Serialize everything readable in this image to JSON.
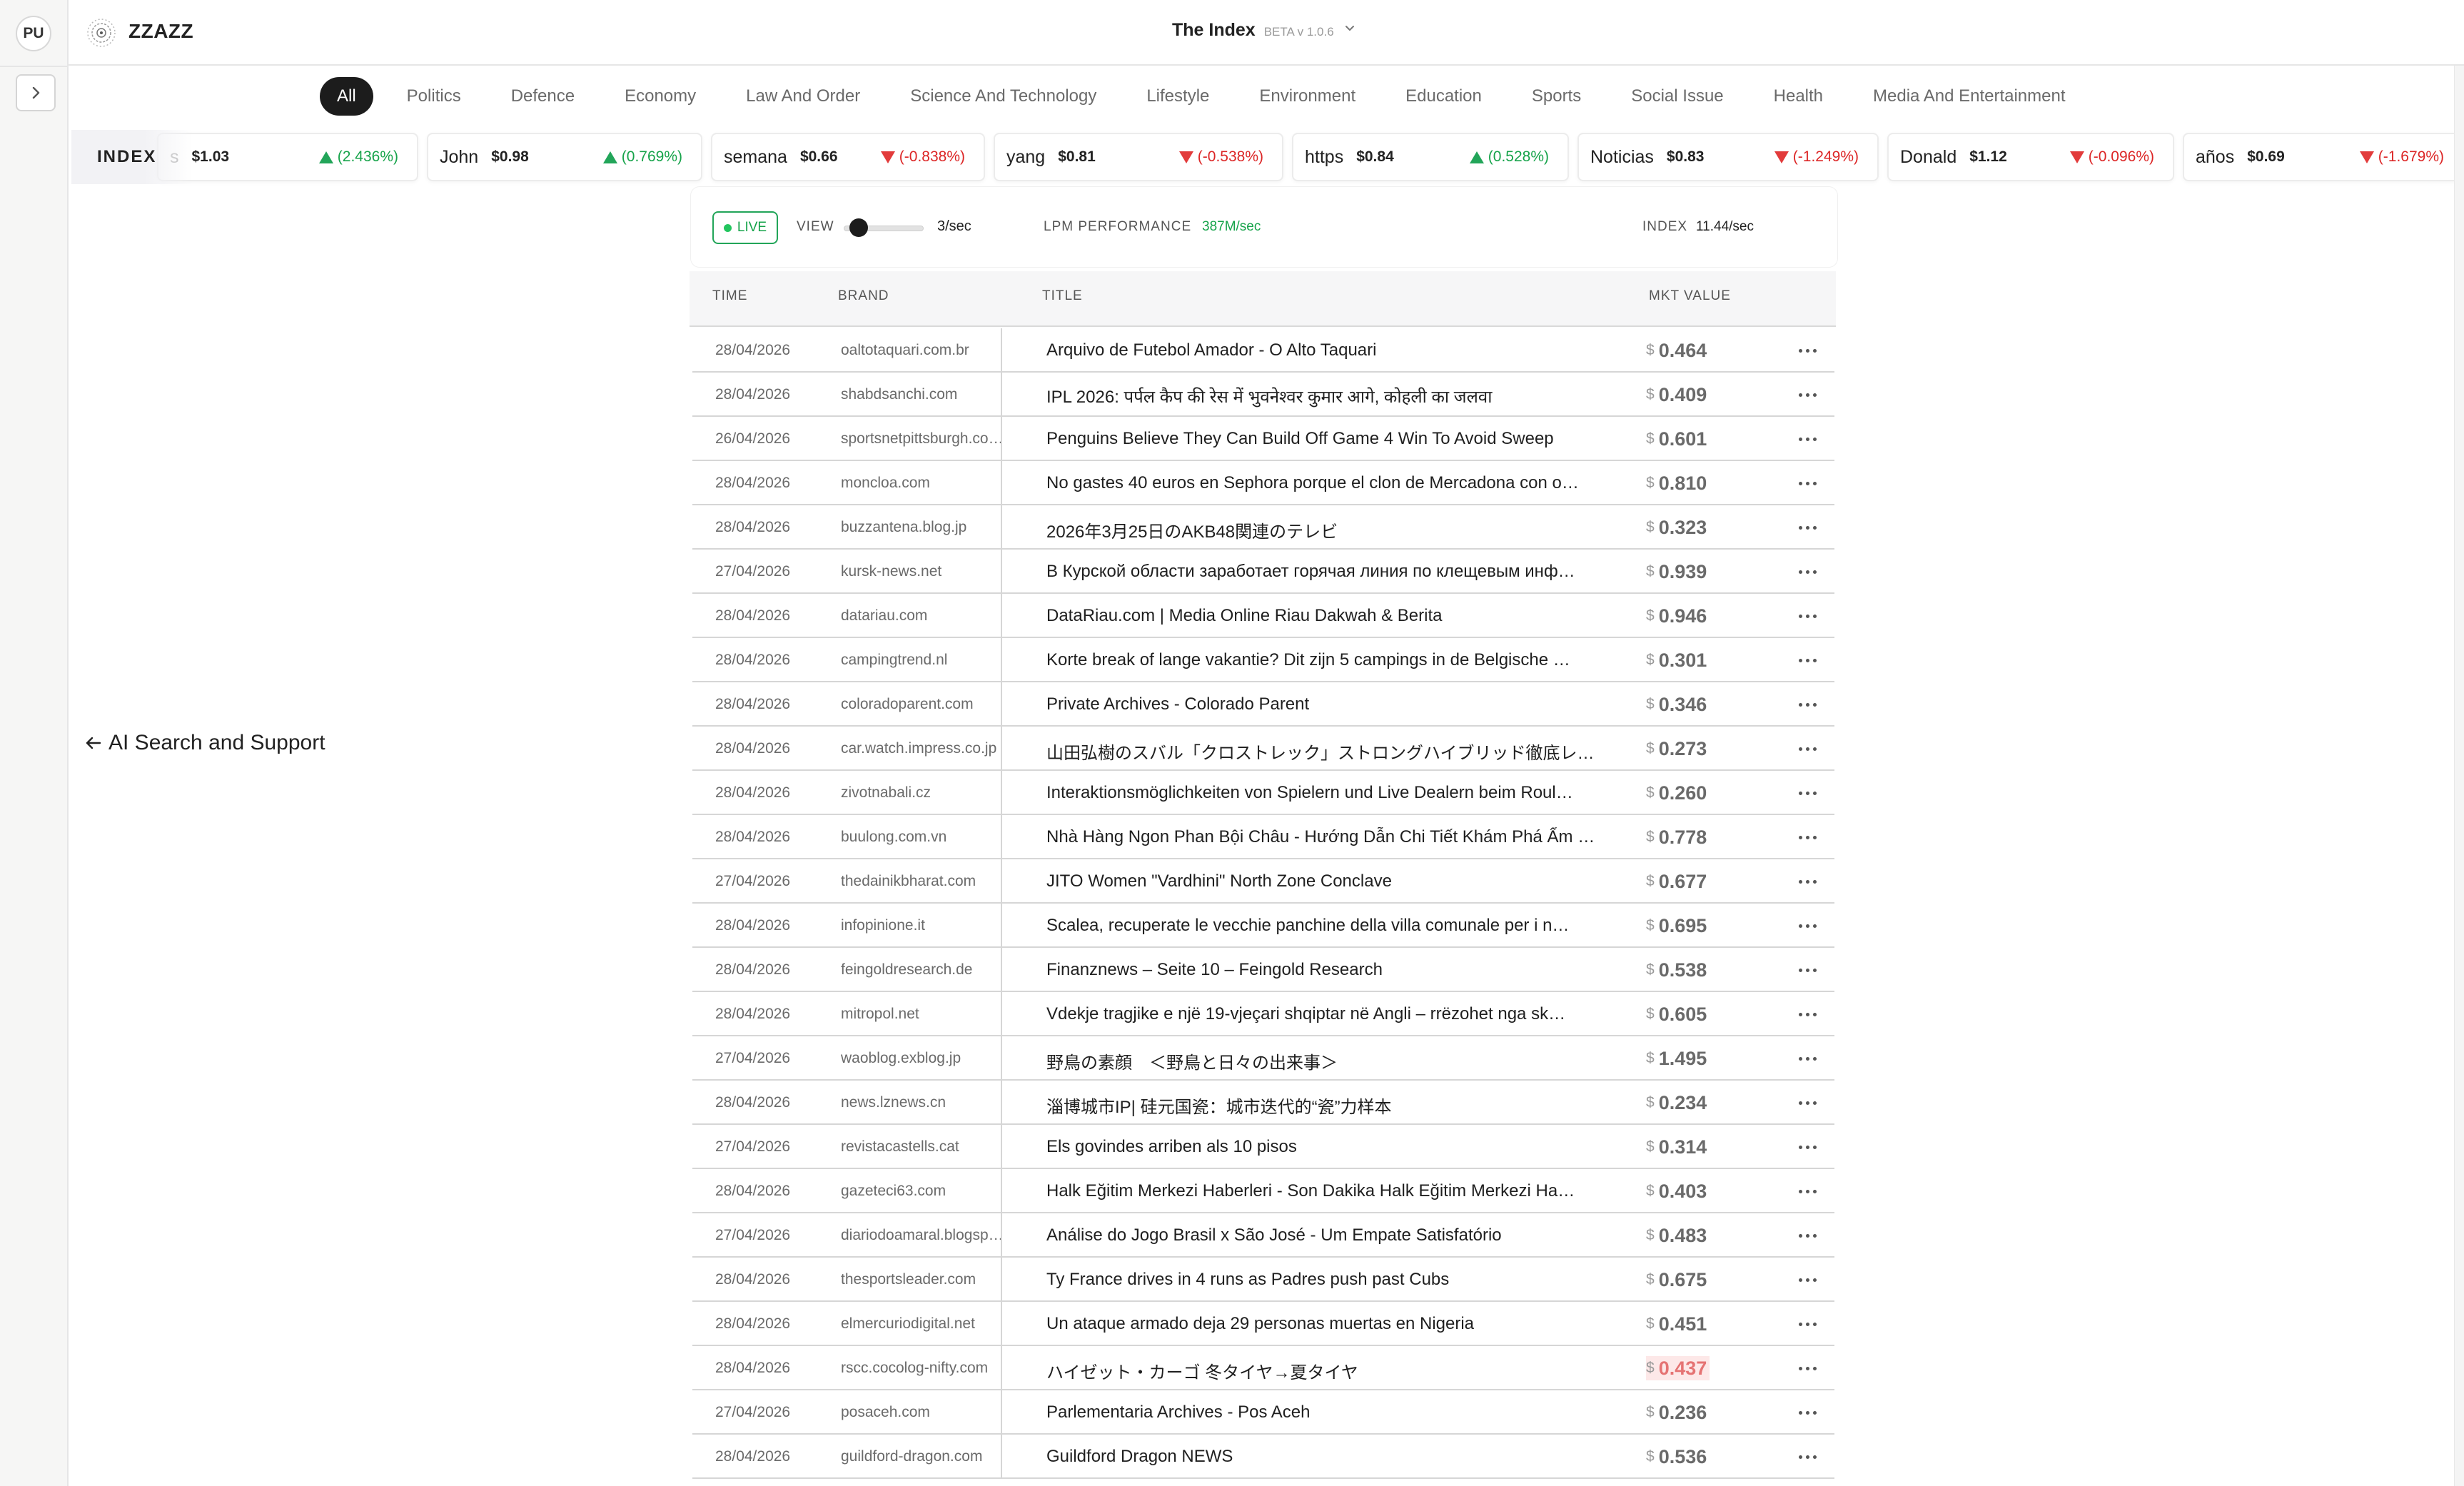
{
  "rail": {
    "avatar": "PU"
  },
  "header": {
    "brand": "ZZAZZ",
    "title": "The Index",
    "version": "BETA v 1.0.6"
  },
  "tabs": [
    {
      "label": "All",
      "active": true
    },
    {
      "label": "Politics"
    },
    {
      "label": "Defence"
    },
    {
      "label": "Economy"
    },
    {
      "label": "Law And Order"
    },
    {
      "label": "Science And Technology"
    },
    {
      "label": "Lifestyle"
    },
    {
      "label": "Environment"
    },
    {
      "label": "Education"
    },
    {
      "label": "Sports"
    },
    {
      "label": "Social Issue"
    },
    {
      "label": "Health"
    },
    {
      "label": "Media And Entertainment"
    }
  ],
  "ticker": {
    "label": "INDEX",
    "items": [
      {
        "name": "s",
        "price": "$1.03",
        "change": "(2.436%)",
        "dir": "up"
      },
      {
        "name": "John",
        "price": "$0.98",
        "change": "(0.769%)",
        "dir": "up"
      },
      {
        "name": "semana",
        "price": "$0.66",
        "change": "(-0.838%)",
        "dir": "down"
      },
      {
        "name": "yang",
        "price": "$0.81",
        "change": "(-0.538%)",
        "dir": "down"
      },
      {
        "name": "https",
        "price": "$0.84",
        "change": "(0.528%)",
        "dir": "up"
      },
      {
        "name": "Noticias",
        "price": "$0.83",
        "change": "(-1.249%)",
        "dir": "down"
      },
      {
        "name": "Donald",
        "price": "$1.12",
        "change": "(-0.096%)",
        "dir": "down"
      },
      {
        "name": "años",
        "price": "$0.69",
        "change": "(-1.679%)",
        "dir": "down"
      }
    ]
  },
  "panel": {
    "live": "LIVE",
    "view_label": "VIEW",
    "view_rate": "3/sec",
    "lpm_label": "LPM PERFORMANCE",
    "lpm_value": "387M/sec",
    "index_label": "INDEX",
    "index_value": "11.44/sec"
  },
  "table": {
    "headers": {
      "time": "TIME",
      "brand": "BRAND",
      "title": "TITLE",
      "value": "MKT VALUE"
    },
    "currency": "$",
    "rows": [
      {
        "time": "28/04/2026",
        "brand": "oaltotaquari.com.br",
        "title": "Arquivo de Futebol Amador - O Alto Taquari",
        "value": "0.464"
      },
      {
        "time": "28/04/2026",
        "brand": "shabdsanchi.com",
        "title": "IPL 2026: पर्पल कैप की रेस में भुवनेश्वर कुमार आगे, कोहली का जलवा",
        "value": "0.409"
      },
      {
        "time": "26/04/2026",
        "brand": "sportsnetpittsburgh.co…",
        "title": "Penguins Believe They Can Build Off Game 4 Win To Avoid Sweep",
        "value": "0.601"
      },
      {
        "time": "28/04/2026",
        "brand": "moncloa.com",
        "title": "No gastes 40 euros en Sephora porque el clon de Mercadona con o…",
        "value": "0.810"
      },
      {
        "time": "28/04/2026",
        "brand": "buzzantena.blog.jp",
        "title": "2026年3月25日のAKB48関連のテレビ",
        "value": "0.323"
      },
      {
        "time": "27/04/2026",
        "brand": "kursk-news.net",
        "title": "В Курской области заработает горячая линия по клещевым инф…",
        "value": "0.939"
      },
      {
        "time": "28/04/2026",
        "brand": "datariau.com",
        "title": "DataRiau.com | Media Online Riau Dakwah & Berita",
        "value": "0.946"
      },
      {
        "time": "28/04/2026",
        "brand": "campingtrend.nl",
        "title": "Korte break of lange vakantie? Dit zijn 5 campings in de Belgische …",
        "value": "0.301"
      },
      {
        "time": "28/04/2026",
        "brand": "coloradoparent.com",
        "title": "Private Archives - Colorado Parent",
        "value": "0.346"
      },
      {
        "time": "28/04/2026",
        "brand": "car.watch.impress.co.jp",
        "title": "山田弘樹のスバル「クロストレック」ストロングハイブリッド徹底レポ…",
        "value": "0.273"
      },
      {
        "time": "28/04/2026",
        "brand": "zivotnabali.cz",
        "title": "Interaktionsmöglichkeiten von Spielern und Live Dealern beim Roul…",
        "value": "0.260"
      },
      {
        "time": "28/04/2026",
        "brand": "buulong.com.vn",
        "title": "Nhà Hàng Ngon Phan Bội Châu - Hướng Dẫn Chi Tiết Khám Phá Ẩm …",
        "value": "0.778"
      },
      {
        "time": "27/04/2026",
        "brand": "thedainikbharat.com",
        "title": "JITO Women \"Vardhini\" North Zone Conclave",
        "value": "0.677"
      },
      {
        "time": "28/04/2026",
        "brand": "infopinione.it",
        "title": "Scalea, recuperate le vecchie panchine della villa comunale per i n…",
        "value": "0.695"
      },
      {
        "time": "28/04/2026",
        "brand": "feingoldresearch.de",
        "title": "Finanznews – Seite 10 – Feingold Research",
        "value": "0.538"
      },
      {
        "time": "28/04/2026",
        "brand": "mitropol.net",
        "title": "Vdekje tragjike e një 19-vjeçari shqiptar në Angli – rrëzohet nga sk…",
        "value": "0.605"
      },
      {
        "time": "27/04/2026",
        "brand": "waoblog.exblog.jp",
        "title": "野鳥の素顔　＜野鳥と日々の出来事＞",
        "value": "1.495"
      },
      {
        "time": "28/04/2026",
        "brand": "news.lznews.cn",
        "title": "淄博城市IP| 硅元国瓷：城市迭代的“瓷”力样本",
        "value": "0.234"
      },
      {
        "time": "27/04/2026",
        "brand": "revistacastells.cat",
        "title": "Els govindes arriben als 10 pisos",
        "value": "0.314"
      },
      {
        "time": "28/04/2026",
        "brand": "gazeteci63.com",
        "title": "Halk Eğitim Merkezi Haberleri - Son Dakika Halk Eğitim Merkezi Ha…",
        "value": "0.403"
      },
      {
        "time": "27/04/2026",
        "brand": "diariodoamaral.blogsp…",
        "title": "Análise do Jogo Brasil x São José - Um Empate Satisfatório",
        "value": "0.483"
      },
      {
        "time": "28/04/2026",
        "brand": "thesportsleader.com",
        "title": "Ty France drives in 4 runs as Padres push past Cubs",
        "value": "0.675"
      },
      {
        "time": "28/04/2026",
        "brand": "elmercuriodigital.net",
        "title": "Un ataque armado deja 29 personas muertas en Nigeria",
        "value": "0.451"
      },
      {
        "time": "28/04/2026",
        "brand": "rscc.cocolog-nifty.com",
        "title": "ハイゼット・カーゴ 冬タイヤ→夏タイヤ",
        "value": "0.437",
        "highlight": true
      },
      {
        "time": "27/04/2026",
        "brand": "posaceh.com",
        "title": "Parlementaria Archives - Pos Aceh",
        "value": "0.236"
      },
      {
        "time": "28/04/2026",
        "brand": "guildford-dragon.com",
        "title": "Guildford Dragon NEWS",
        "value": "0.536"
      }
    ]
  },
  "ai_link": "AI Search and Support",
  "icons": {
    "toggle": "chevron-right-icon",
    "logo": "zzazz-logo-icon",
    "dropdown": "chevron-down-icon",
    "more": "more-horizontal-icon",
    "arrow": "arrow-left-icon"
  }
}
